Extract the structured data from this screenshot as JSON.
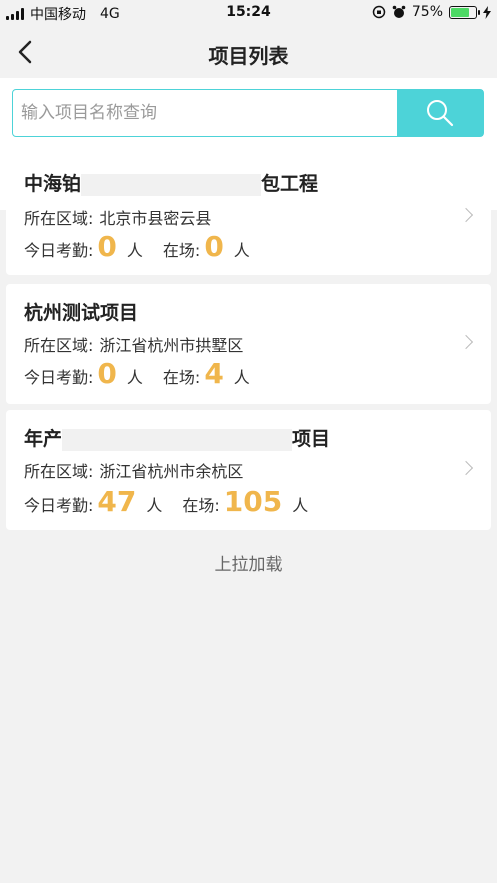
{
  "status_bar": {
    "carrier": "中国移动",
    "network": "4G",
    "time": "15:24",
    "battery_percent": "75%",
    "battery_level": 0.75,
    "battery_color": "#4cd964"
  },
  "nav": {
    "title": "项目列表",
    "back_icon": "chevron-left-icon"
  },
  "search": {
    "placeholder": "输入项目名称查询",
    "value": "",
    "button_icon": "search-icon",
    "accent_color": "#4dd3d8"
  },
  "labels": {
    "region": "所在区域:",
    "attendance": "今日考勤:",
    "onsite": "在场:",
    "unit": "人"
  },
  "projects": [
    {
      "title_start": "中海铂",
      "title_end": "包工程",
      "region": "北京市县密云县",
      "attendance": "0",
      "onsite": "0"
    },
    {
      "title_start": "杭州测试项目",
      "title_end": "",
      "region": "浙江省杭州市拱墅区",
      "attendance": "0",
      "onsite": "4"
    },
    {
      "title_start": "年产",
      "title_end": "项目",
      "region": "浙江省杭州市余杭区",
      "attendance": "47",
      "onsite": "105"
    }
  ],
  "load_more": "上拉加载",
  "number_color": "#f0b64c"
}
